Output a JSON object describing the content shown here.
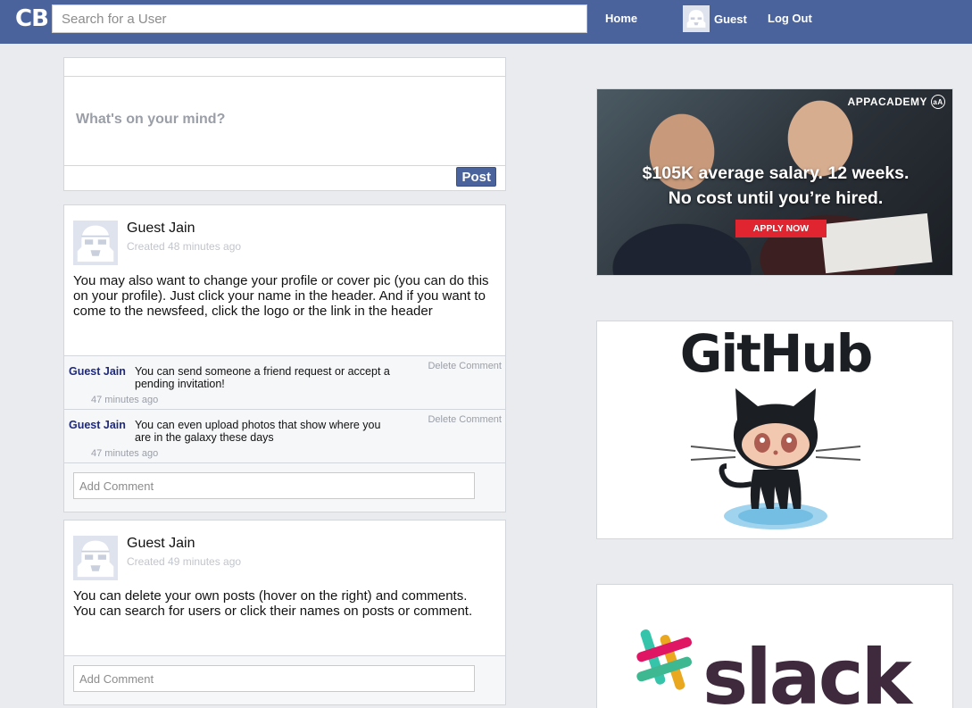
{
  "header": {
    "logo": "CB",
    "search_placeholder": "Search for a User",
    "home_label": "Home",
    "user_label": "Guest",
    "logout_label": "Log Out"
  },
  "composer": {
    "placeholder": "What's on your mind?",
    "post_label": "Post"
  },
  "posts": [
    {
      "author": "Guest Jain",
      "created": "Created 48 minutes ago",
      "body": "You may also want to change your profile or cover pic (you can do this on your profile). Just click your name in the header. And if you want to come to the newsfeed, click the logo or the link in the header",
      "comments": [
        {
          "author": "Guest Jain",
          "text": "You can send someone a friend request or accept a pending invitation!",
          "time": "47 minutes ago",
          "delete_label": "Delete Comment"
        },
        {
          "author": "Guest Jain",
          "text": "You can even upload photos that show where you are in the galaxy these days",
          "time": "47 minutes ago",
          "delete_label": "Delete Comment"
        }
      ],
      "add_comment_placeholder": "Add Comment"
    },
    {
      "author": "Guest Jain",
      "created": "Created 49 minutes ago",
      "body": "You can delete your own posts (hover on the right) and comments. You can search for users or click their names on posts or comment.",
      "comments": [],
      "add_comment_placeholder": "Add Comment"
    }
  ],
  "ads": {
    "appacademy": {
      "brand": "APPACADEMY",
      "headline_line1": "$105K average salary. 12 weeks.",
      "headline_line2": "No cost until you’re hired.",
      "cta": "APPLY NOW",
      "cta_color": "#e02430"
    },
    "github": {
      "wordmark": "GitHub"
    },
    "slack": {
      "wordmark": "slack"
    }
  },
  "colors": {
    "header_bg": "#4a639d",
    "page_bg": "#e9ebee",
    "comment_author": "#1f2a7a"
  },
  "icons": {
    "avatar": "stormtrooper-avatar-icon",
    "github": "octocat-icon",
    "slack": "slack-hash-icon"
  }
}
